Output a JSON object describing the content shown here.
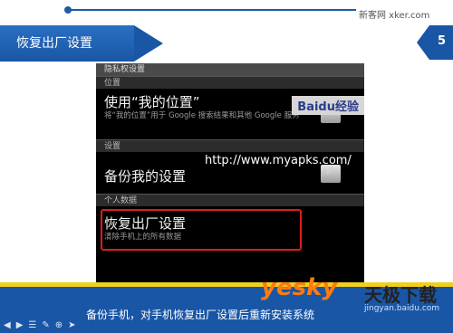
{
  "header": {
    "watermark": "新客网 xker.com",
    "title": "恢复出厂设置",
    "page_number": "5"
  },
  "phone": {
    "screen_title": "隐私权设置",
    "sections": {
      "location": "位置",
      "settings": "设置",
      "personal": "个人数据"
    },
    "items": {
      "use_location": {
        "label": "使用“我的位置”",
        "desc": "将“我的位置”用于 Google 搜索结果和其他 Google 服务"
      },
      "backup": {
        "label": "备份我的设置"
      },
      "factory_reset": {
        "label": "恢复出厂设置",
        "desc": "清除手机上的所有数据"
      }
    },
    "watermark": "http://www.myapks.com/",
    "baidu_logo": "Baidu经验"
  },
  "footer": {
    "caption": "备份手机，对手机恢复出厂设置后重新安装系统",
    "brand_yesky": "yesky",
    "brand_tianji": "天极下载",
    "baidu_url": "jingyan.baidu.com",
    "nav_icons": [
      "prev-icon",
      "next-icon",
      "menu-icon",
      "pen-icon",
      "zoom-icon",
      "pointer-icon"
    ]
  }
}
